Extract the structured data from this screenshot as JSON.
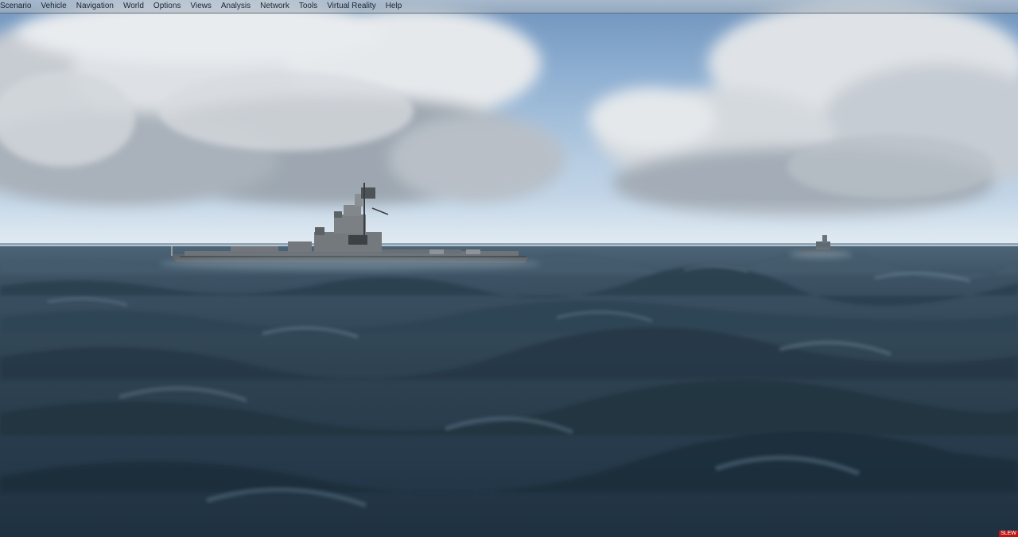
{
  "menubar": {
    "items": [
      {
        "label": "Scenario"
      },
      {
        "label": "Vehicle"
      },
      {
        "label": "Navigation"
      },
      {
        "label": "World"
      },
      {
        "label": "Options"
      },
      {
        "label": "Views"
      },
      {
        "label": "Analysis"
      },
      {
        "label": "Network"
      },
      {
        "label": "Tools"
      },
      {
        "label": "Virtual Reality"
      },
      {
        "label": "Help"
      }
    ]
  },
  "status": {
    "slew_badge": "SLEW"
  },
  "colors": {
    "sky_top": "#6f93bd",
    "sea_dark": "#1f3140",
    "ship_hull": "#5e6468",
    "slew_badge_bg": "#c21313"
  }
}
